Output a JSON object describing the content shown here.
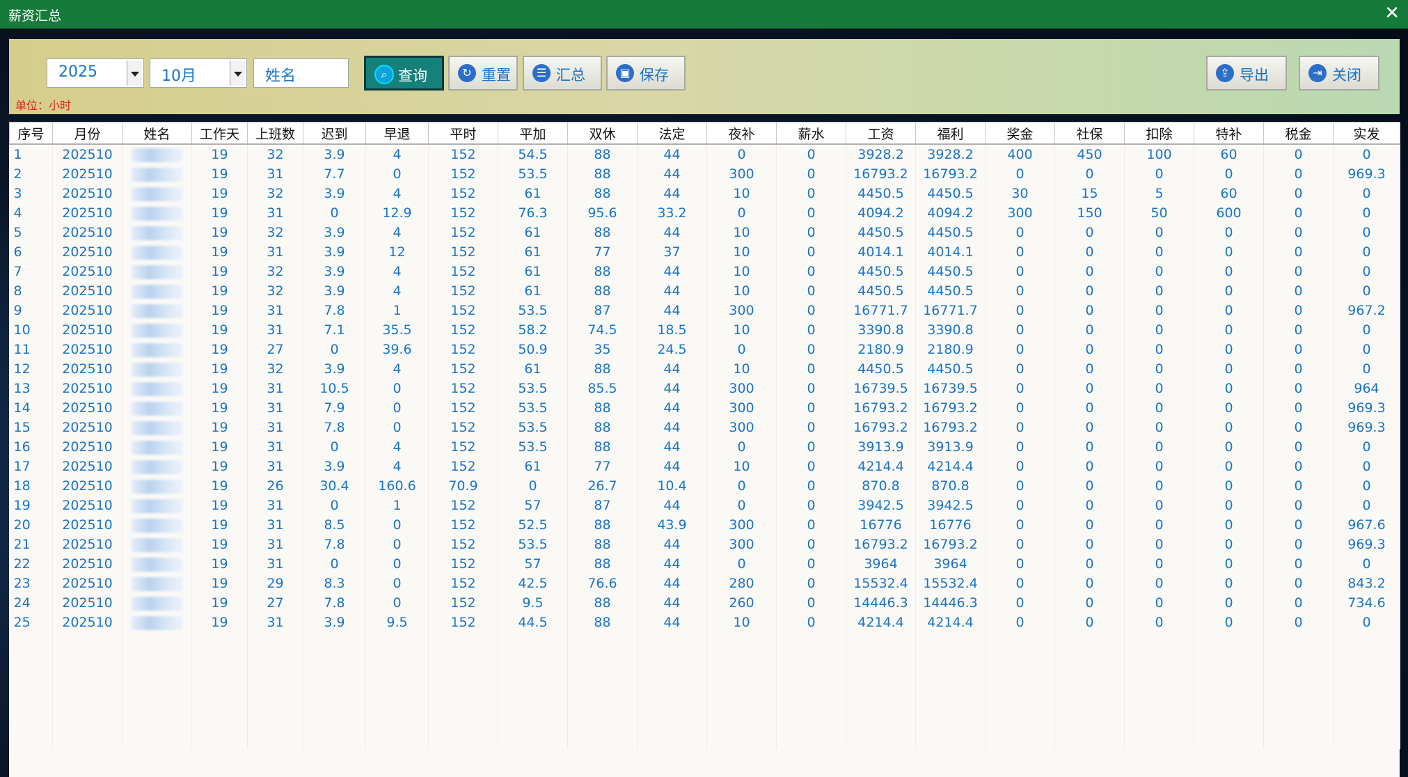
{
  "window": {
    "title": "薪资汇总",
    "close_icon": "close-icon"
  },
  "toolbar": {
    "year": "2025",
    "month": "10月",
    "name_placeholder": "姓名",
    "query": "查询",
    "reset": "重置",
    "summary": "汇总",
    "save": "保存",
    "export": "导出",
    "close": "关闭",
    "unit": "单位：小时"
  },
  "table": {
    "headers": [
      "序号",
      "月份",
      "姓名",
      "工作天",
      "上班数",
      "迟到",
      "早退",
      "平时",
      "平加",
      "双休",
      "法定",
      "夜补",
      "薪水",
      "工资",
      "福利",
      "奖金",
      "社保",
      "扣除",
      "特补",
      "税金",
      "实发"
    ],
    "rows": [
      [
        "1",
        "202510",
        "",
        "19",
        "32",
        "3.9",
        "4",
        "152",
        "54.5",
        "88",
        "44",
        "0",
        "0",
        "3928.2",
        "3928.2",
        "400",
        "450",
        "100",
        "60",
        "0",
        "0"
      ],
      [
        "2",
        "202510",
        "",
        "19",
        "31",
        "7.7",
        "0",
        "152",
        "53.5",
        "88",
        "44",
        "300",
        "0",
        "16793.2",
        "16793.2",
        "0",
        "0",
        "0",
        "0",
        "0",
        "969.3"
      ],
      [
        "3",
        "202510",
        "",
        "19",
        "32",
        "3.9",
        "4",
        "152",
        "61",
        "88",
        "44",
        "10",
        "0",
        "4450.5",
        "4450.5",
        "30",
        "15",
        "5",
        "60",
        "0",
        "0"
      ],
      [
        "4",
        "202510",
        "",
        "19",
        "31",
        "0",
        "12.9",
        "152",
        "76.3",
        "95.6",
        "33.2",
        "0",
        "0",
        "4094.2",
        "4094.2",
        "300",
        "150",
        "50",
        "600",
        "0",
        "0"
      ],
      [
        "5",
        "202510",
        "",
        "19",
        "32",
        "3.9",
        "4",
        "152",
        "61",
        "88",
        "44",
        "10",
        "0",
        "4450.5",
        "4450.5",
        "0",
        "0",
        "0",
        "0",
        "0",
        "0"
      ],
      [
        "6",
        "202510",
        "",
        "19",
        "31",
        "3.9",
        "12",
        "152",
        "61",
        "77",
        "37",
        "10",
        "0",
        "4014.1",
        "4014.1",
        "0",
        "0",
        "0",
        "0",
        "0",
        "0"
      ],
      [
        "7",
        "202510",
        "",
        "19",
        "32",
        "3.9",
        "4",
        "152",
        "61",
        "88",
        "44",
        "10",
        "0",
        "4450.5",
        "4450.5",
        "0",
        "0",
        "0",
        "0",
        "0",
        "0"
      ],
      [
        "8",
        "202510",
        "",
        "19",
        "32",
        "3.9",
        "4",
        "152",
        "61",
        "88",
        "44",
        "10",
        "0",
        "4450.5",
        "4450.5",
        "0",
        "0",
        "0",
        "0",
        "0",
        "0"
      ],
      [
        "9",
        "202510",
        "",
        "19",
        "31",
        "7.8",
        "1",
        "152",
        "53.5",
        "87",
        "44",
        "300",
        "0",
        "16771.7",
        "16771.7",
        "0",
        "0",
        "0",
        "0",
        "0",
        "967.2"
      ],
      [
        "10",
        "202510",
        "",
        "19",
        "31",
        "7.1",
        "35.5",
        "152",
        "58.2",
        "74.5",
        "18.5",
        "10",
        "0",
        "3390.8",
        "3390.8",
        "0",
        "0",
        "0",
        "0",
        "0",
        "0"
      ],
      [
        "11",
        "202510",
        "",
        "19",
        "27",
        "0",
        "39.6",
        "152",
        "50.9",
        "35",
        "24.5",
        "0",
        "0",
        "2180.9",
        "2180.9",
        "0",
        "0",
        "0",
        "0",
        "0",
        "0"
      ],
      [
        "12",
        "202510",
        "",
        "19",
        "32",
        "3.9",
        "4",
        "152",
        "61",
        "88",
        "44",
        "10",
        "0",
        "4450.5",
        "4450.5",
        "0",
        "0",
        "0",
        "0",
        "0",
        "0"
      ],
      [
        "13",
        "202510",
        "",
        "19",
        "31",
        "10.5",
        "0",
        "152",
        "53.5",
        "85.5",
        "44",
        "300",
        "0",
        "16739.5",
        "16739.5",
        "0",
        "0",
        "0",
        "0",
        "0",
        "964"
      ],
      [
        "14",
        "202510",
        "",
        "19",
        "31",
        "7.9",
        "0",
        "152",
        "53.5",
        "88",
        "44",
        "300",
        "0",
        "16793.2",
        "16793.2",
        "0",
        "0",
        "0",
        "0",
        "0",
        "969.3"
      ],
      [
        "15",
        "202510",
        "",
        "19",
        "31",
        "7.8",
        "0",
        "152",
        "53.5",
        "88",
        "44",
        "300",
        "0",
        "16793.2",
        "16793.2",
        "0",
        "0",
        "0",
        "0",
        "0",
        "969.3"
      ],
      [
        "16",
        "202510",
        "",
        "19",
        "31",
        "0",
        "4",
        "152",
        "53.5",
        "88",
        "44",
        "0",
        "0",
        "3913.9",
        "3913.9",
        "0",
        "0",
        "0",
        "0",
        "0",
        "0"
      ],
      [
        "17",
        "202510",
        "",
        "19",
        "31",
        "3.9",
        "4",
        "152",
        "61",
        "77",
        "44",
        "10",
        "0",
        "4214.4",
        "4214.4",
        "0",
        "0",
        "0",
        "0",
        "0",
        "0"
      ],
      [
        "18",
        "202510",
        "",
        "19",
        "26",
        "30.4",
        "160.6",
        "70.9",
        "0",
        "26.7",
        "10.4",
        "0",
        "0",
        "870.8",
        "870.8",
        "0",
        "0",
        "0",
        "0",
        "0",
        "0"
      ],
      [
        "19",
        "202510",
        "",
        "19",
        "31",
        "0",
        "1",
        "152",
        "57",
        "87",
        "44",
        "0",
        "0",
        "3942.5",
        "3942.5",
        "0",
        "0",
        "0",
        "0",
        "0",
        "0"
      ],
      [
        "20",
        "202510",
        "",
        "19",
        "31",
        "8.5",
        "0",
        "152",
        "52.5",
        "88",
        "43.9",
        "300",
        "0",
        "16776",
        "16776",
        "0",
        "0",
        "0",
        "0",
        "0",
        "967.6"
      ],
      [
        "21",
        "202510",
        "",
        "19",
        "31",
        "7.8",
        "0",
        "152",
        "53.5",
        "88",
        "44",
        "300",
        "0",
        "16793.2",
        "16793.2",
        "0",
        "0",
        "0",
        "0",
        "0",
        "969.3"
      ],
      [
        "22",
        "202510",
        "",
        "19",
        "31",
        "0",
        "0",
        "152",
        "57",
        "88",
        "44",
        "0",
        "0",
        "3964",
        "3964",
        "0",
        "0",
        "0",
        "0",
        "0",
        "0"
      ],
      [
        "23",
        "202510",
        "",
        "19",
        "29",
        "8.3",
        "0",
        "152",
        "42.5",
        "76.6",
        "44",
        "280",
        "0",
        "15532.4",
        "15532.4",
        "0",
        "0",
        "0",
        "0",
        "0",
        "843.2"
      ],
      [
        "24",
        "202510",
        "",
        "19",
        "27",
        "7.8",
        "0",
        "152",
        "9.5",
        "88",
        "44",
        "260",
        "0",
        "14446.3",
        "14446.3",
        "0",
        "0",
        "0",
        "0",
        "0",
        "734.6"
      ],
      [
        "25",
        "202510",
        "",
        "19",
        "31",
        "3.9",
        "9.5",
        "152",
        "44.5",
        "88",
        "44",
        "10",
        "0",
        "4214.4",
        "4214.4",
        "0",
        "0",
        "0",
        "0",
        "0",
        "0"
      ]
    ]
  }
}
